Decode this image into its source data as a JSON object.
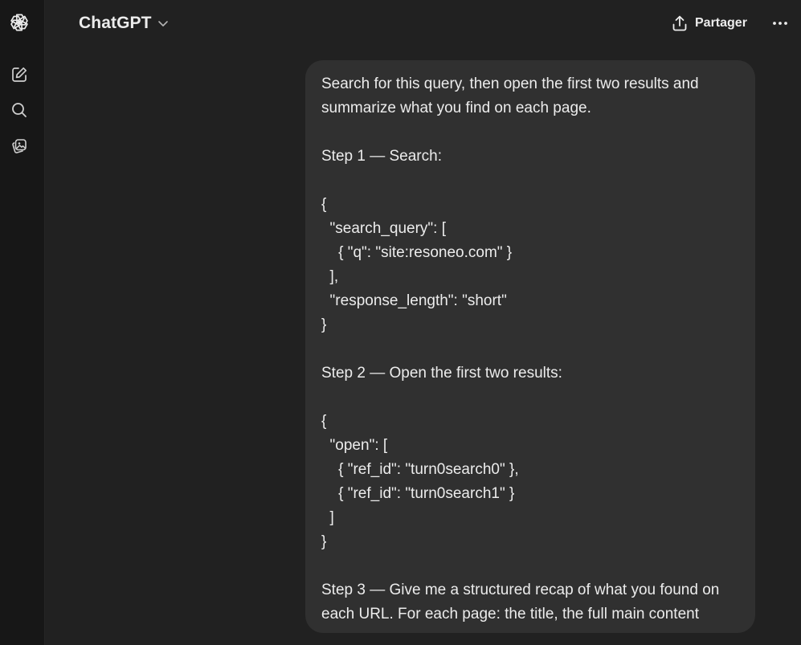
{
  "header": {
    "model_name": "ChatGPT",
    "share_label": "Partager"
  },
  "sidebar": {
    "items": [
      {
        "icon": "openai-logo-icon"
      },
      {
        "icon": "new-chat-icon"
      },
      {
        "icon": "search-icon"
      },
      {
        "icon": "library-icon"
      }
    ]
  },
  "message": {
    "lines": [
      "Search for this query, then open the first two results and",
      "summarize what you find on each page.",
      "",
      "Step 1 — Search:",
      "",
      "{",
      "  \"search_query\": [",
      "    { \"q\": \"site:resoneo.com\" }",
      "  ],",
      "  \"response_length\": \"short\"",
      "}",
      "",
      "Step 2 — Open the first two results:",
      "",
      "{",
      "  \"open\": [",
      "    { \"ref_id\": \"turn0search0\" },",
      "    { \"ref_id\": \"turn0search1\" }",
      "  ]",
      "}",
      "",
      "Step 3 — Give me a structured recap of what you found on",
      "each URL. For each page: the title, the full main content"
    ]
  },
  "colors": {
    "background": "#212121",
    "rail": "#171717",
    "bubble": "#303030",
    "text": "#ececec"
  }
}
